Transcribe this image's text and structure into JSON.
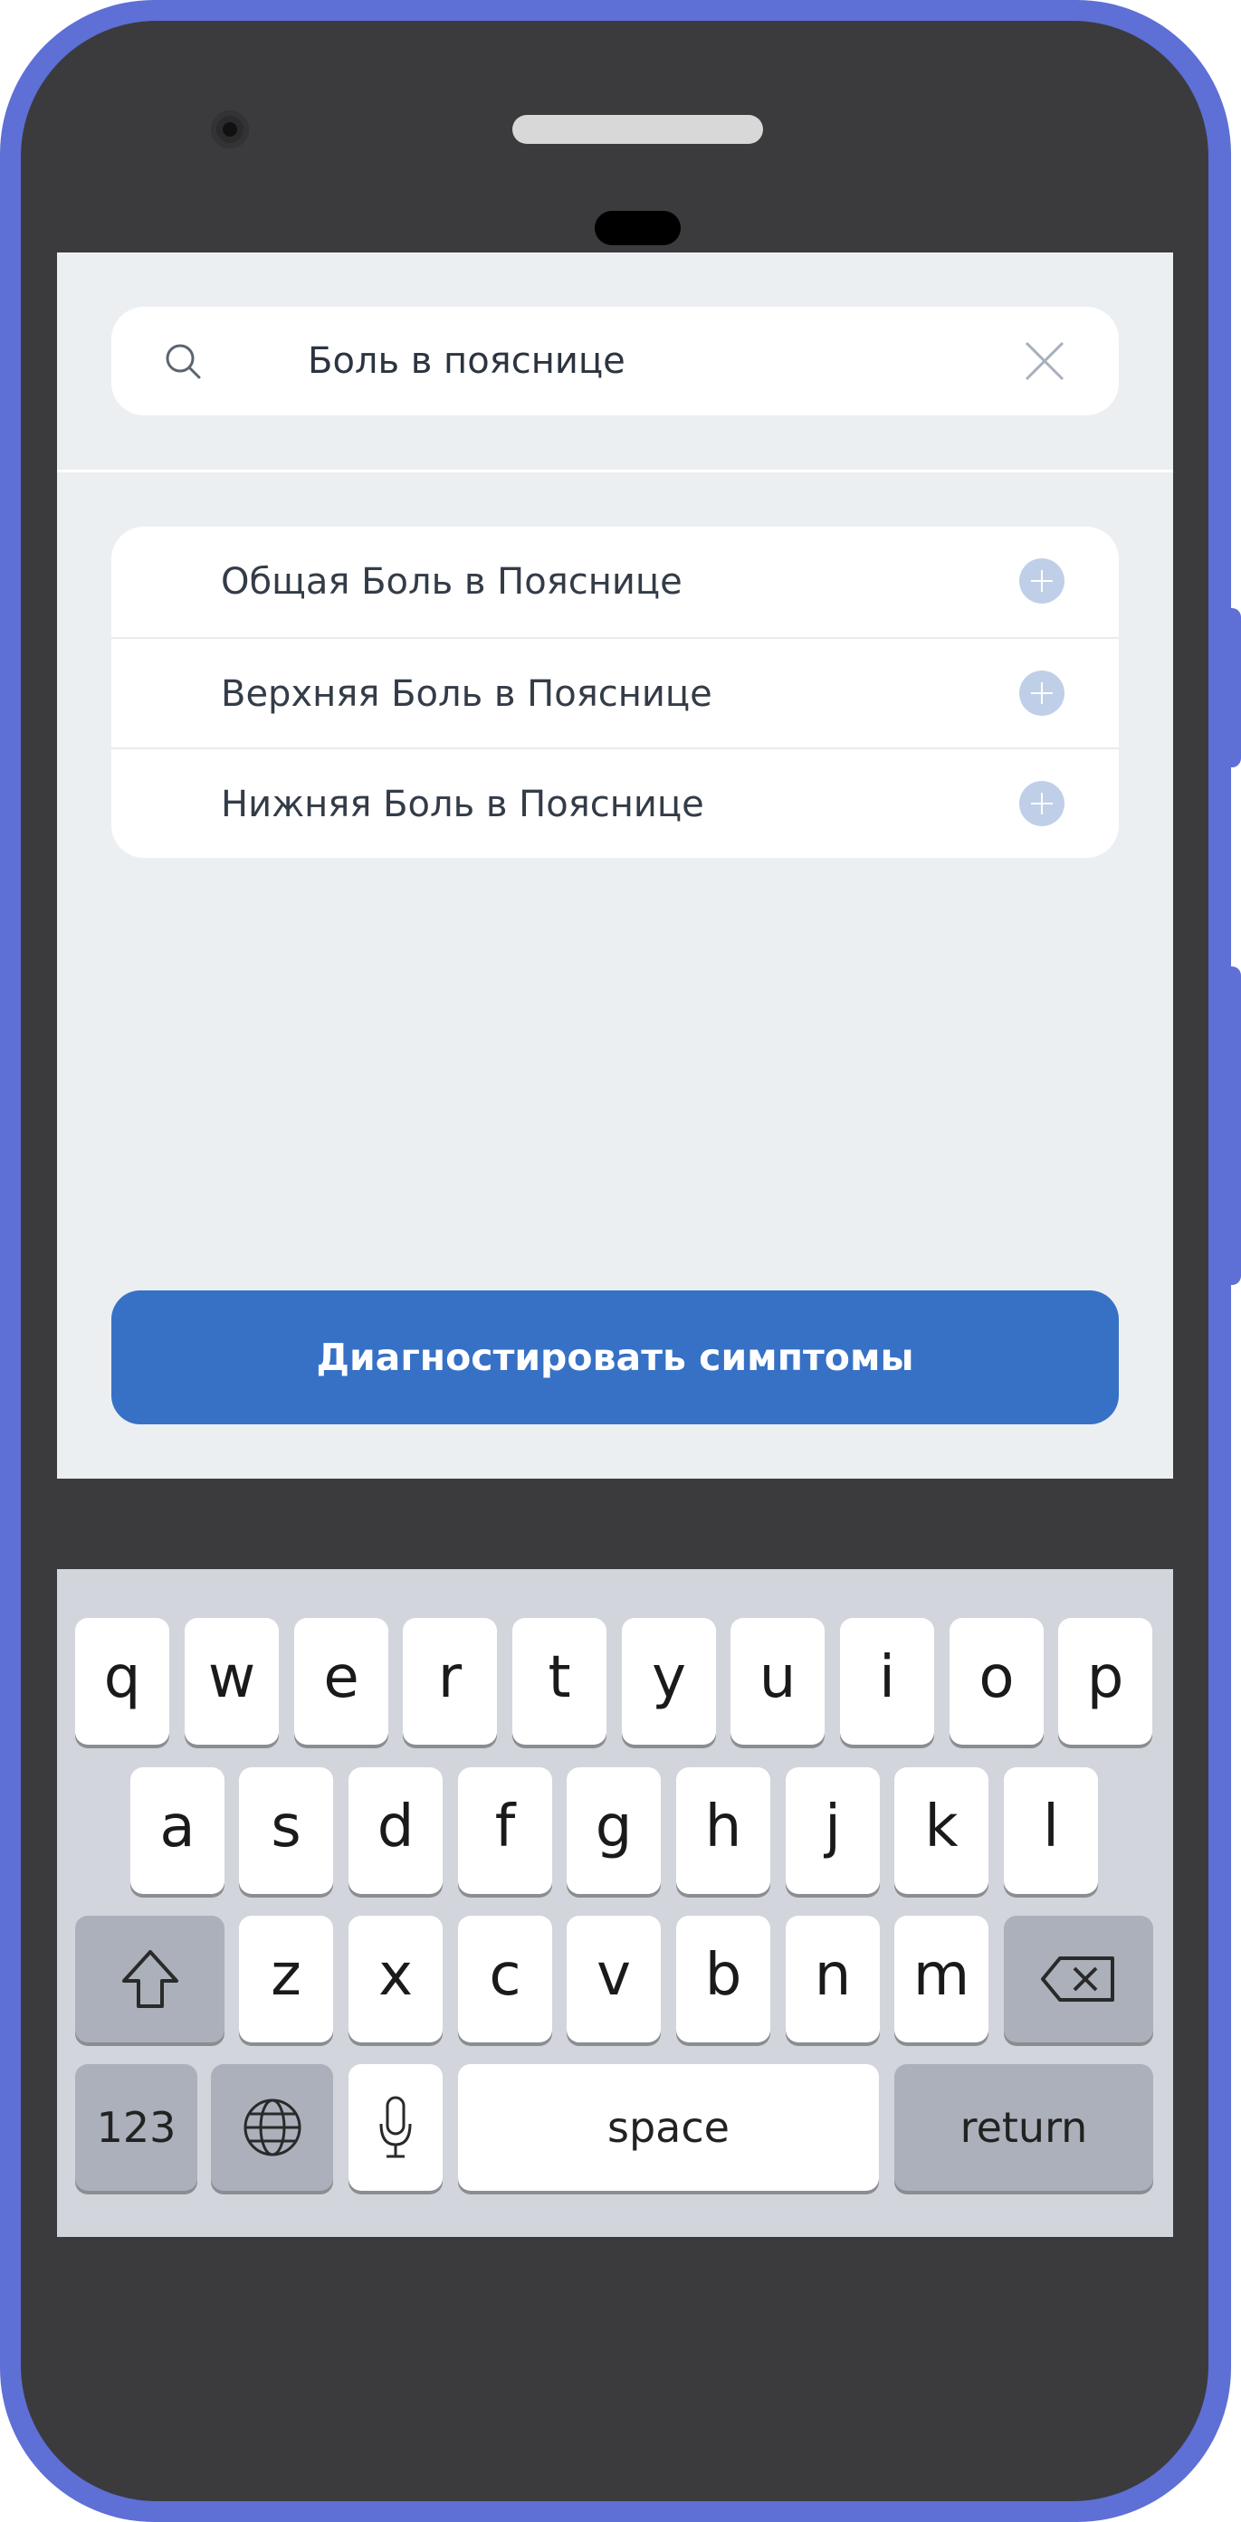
{
  "search": {
    "query": "Боль в пояснице",
    "icon": "search-icon",
    "clear_icon": "close-icon"
  },
  "results": {
    "items": [
      {
        "label": "Общая Боль в Пояснице",
        "icon": "plus-circle-icon"
      },
      {
        "label": "Верхняя Боль в Пояснице",
        "icon": "plus-circle-icon"
      },
      {
        "label": "Нижняя Боль в Пояснице",
        "icon": "plus-circle-icon"
      }
    ]
  },
  "actions": {
    "diagnose_label": "Диагностировать симптомы"
  },
  "keyboard": {
    "row1": [
      "q",
      "w",
      "e",
      "r",
      "t",
      "y",
      "u",
      "i",
      "o",
      "p"
    ],
    "row2": [
      "a",
      "s",
      "d",
      "f",
      "g",
      "h",
      "j",
      "k",
      "l"
    ],
    "row3": [
      "z",
      "x",
      "c",
      "v",
      "b",
      "n",
      "m"
    ],
    "numbers_label": "123",
    "space_label": "space",
    "return_label": "return",
    "icons": [
      "shift-icon",
      "backspace-icon",
      "globe-icon",
      "microphone-icon"
    ]
  },
  "colors": {
    "frame": "#5e6fd6",
    "bezel": "#3b3b3d",
    "screen_bg": "#eceff2",
    "primary_button": "#3771c6",
    "plus_icon": "#c0cfe8",
    "keyboard_bg": "#d2d5db",
    "dark_key": "#abb0ba"
  }
}
